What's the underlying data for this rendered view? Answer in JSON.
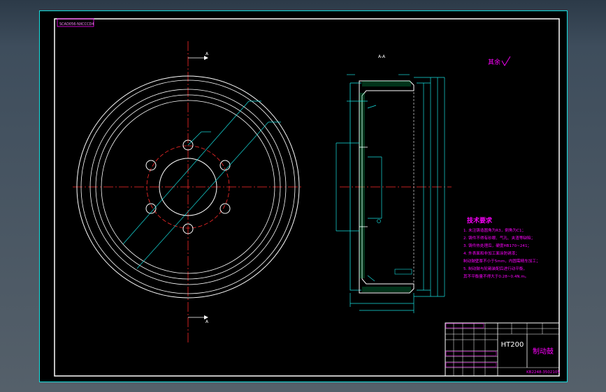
{
  "drawing": {
    "stamp": "SCAD056-NXCCCD4",
    "section_label": "A-A",
    "section_marker_top": "A",
    "section_marker_bottom": "A",
    "finish_note": "其余",
    "material_label": "HT200",
    "part_name": "制动鼓",
    "drawing_number": "KB2248-3502105"
  },
  "requirements": {
    "title": "技术要求",
    "items": [
      "1. 未注铸造圆角为R3，倒角为C1；",
      "2. 铸件不得有砂眼、气孔、夹渣等缺陷；",
      "3. 铸件热处理后，硬度HB170~241；",
      "4. 外表面和非加工面涂防锈漆；",
      "   制动鼓壁厚不小于5mm，内圆需精车加工；",
      "5. 制动鼓与轮毂装配后进行动平衡，",
      "   其不平衡量不得大于0.28~0.4N.m。"
    ]
  },
  "colors": {
    "background": "#000000",
    "border": "#ffffff",
    "outline": "#ffffff",
    "centerline": "#ff2a2a",
    "dimension": "#16e0e0",
    "hatch": "#00cc66",
    "text_magenta": "#ff00ff",
    "title_block": "#ffffff"
  }
}
